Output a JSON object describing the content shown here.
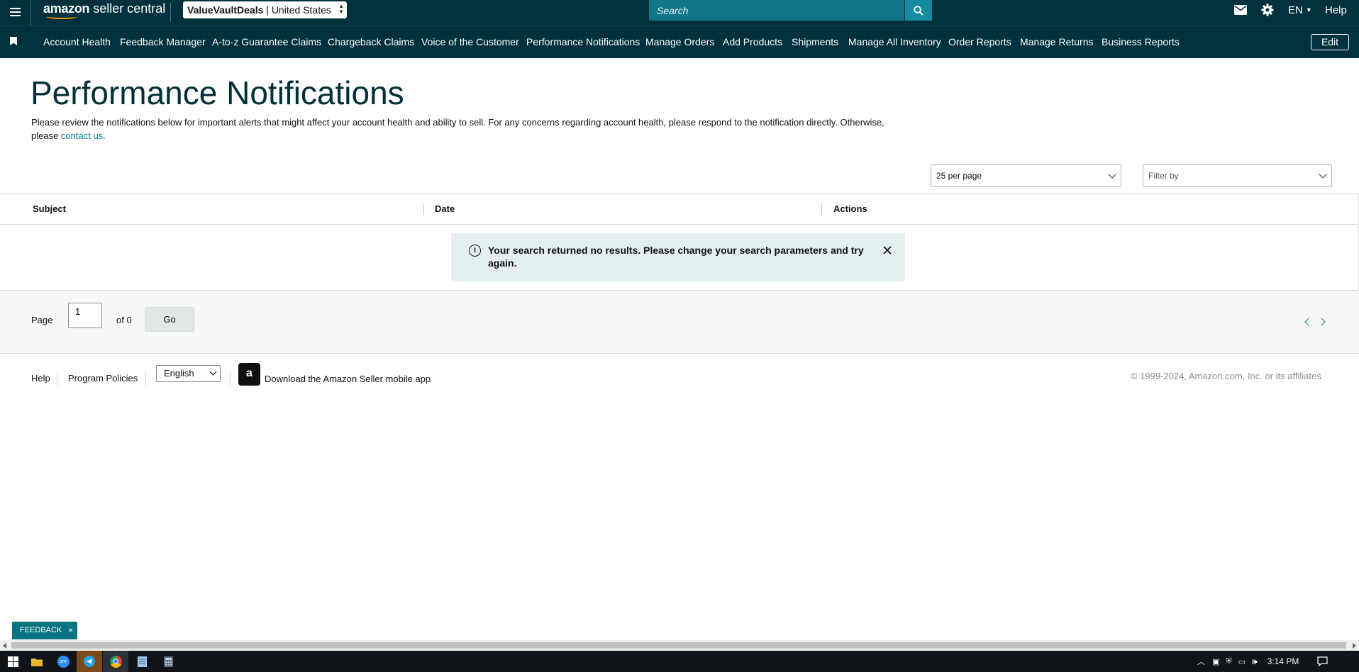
{
  "topbar": {
    "logo_brand": "amazon",
    "logo_suffix": "seller central",
    "account_name": "ValueVaultDeals",
    "account_marketplace": "| United States",
    "search_placeholder": "Search",
    "language": "EN",
    "help": "Help"
  },
  "nav": {
    "items": [
      "Account Health",
      "Feedback Manager",
      "A-to-z Guarantee Claims",
      "Chargeback Claims",
      "Voice of the Customer",
      "Performance Notifications",
      "Manage Orders",
      "Add Products",
      "Shipments",
      "Manage All Inventory",
      "Order Reports",
      "Manage Returns",
      "Business Reports"
    ],
    "edit": "Edit"
  },
  "main": {
    "title": "Performance Notifications",
    "intro": "Please review the notifications below for important alerts that might affect your account health and ability to sell. For any concerns regarding account health, please respond to the notification directly. Otherwise, please ",
    "contact_link": "contact us.",
    "per_page": "25 per page",
    "filter_placeholder": "Filter by",
    "columns": [
      "Subject",
      "Date",
      "Actions"
    ],
    "alert_message": "Your search returned no results. Please change your search parameters and try again."
  },
  "pager": {
    "label": "Page",
    "current": "1",
    "of_total": "of 0",
    "go": "Go"
  },
  "footer": {
    "help": "Help",
    "policies": "Program Policies",
    "language": "English",
    "app_icon_letter": "a",
    "app_link": "Download the Amazon Seller mobile app",
    "copyright": "© 1999-2024, Amazon.com, Inc. or its affiliates"
  },
  "feedback": {
    "label": "FEEDBACK",
    "close": "×"
  },
  "taskbar": {
    "apps": [
      "windows-start-icon",
      "file-explorer-icon",
      "zoom-icon",
      "telegram-icon",
      "chrome-icon",
      "notepad-icon",
      "calculator-icon"
    ],
    "clock": "3:14 PM",
    "zoom_label": "zm"
  },
  "colors": {
    "header_bg": "#00313d",
    "search_bg": "#117687",
    "accent_link": "#008296",
    "alert_bg": "#e3eff0",
    "feedback_bg": "#087580",
    "brand_orange": "#ff9900"
  }
}
